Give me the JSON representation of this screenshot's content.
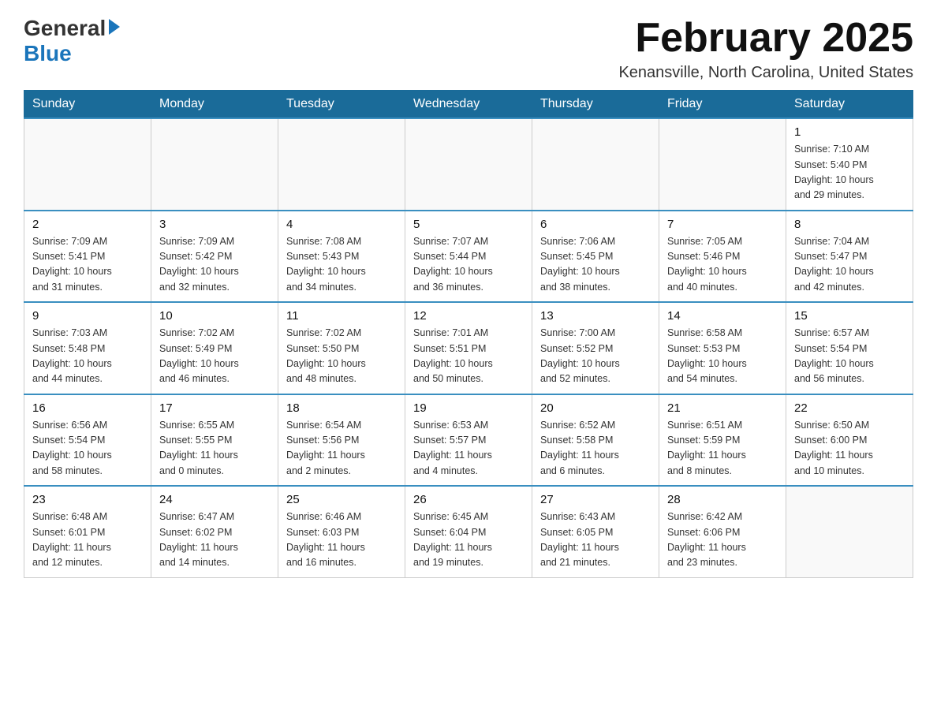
{
  "logo": {
    "line1": "General",
    "line2": "Blue"
  },
  "title": "February 2025",
  "location": "Kenansville, North Carolina, United States",
  "days_of_week": [
    "Sunday",
    "Monday",
    "Tuesday",
    "Wednesday",
    "Thursday",
    "Friday",
    "Saturday"
  ],
  "weeks": [
    [
      {
        "day": "",
        "info": ""
      },
      {
        "day": "",
        "info": ""
      },
      {
        "day": "",
        "info": ""
      },
      {
        "day": "",
        "info": ""
      },
      {
        "day": "",
        "info": ""
      },
      {
        "day": "",
        "info": ""
      },
      {
        "day": "1",
        "info": "Sunrise: 7:10 AM\nSunset: 5:40 PM\nDaylight: 10 hours\nand 29 minutes."
      }
    ],
    [
      {
        "day": "2",
        "info": "Sunrise: 7:09 AM\nSunset: 5:41 PM\nDaylight: 10 hours\nand 31 minutes."
      },
      {
        "day": "3",
        "info": "Sunrise: 7:09 AM\nSunset: 5:42 PM\nDaylight: 10 hours\nand 32 minutes."
      },
      {
        "day": "4",
        "info": "Sunrise: 7:08 AM\nSunset: 5:43 PM\nDaylight: 10 hours\nand 34 minutes."
      },
      {
        "day": "5",
        "info": "Sunrise: 7:07 AM\nSunset: 5:44 PM\nDaylight: 10 hours\nand 36 minutes."
      },
      {
        "day": "6",
        "info": "Sunrise: 7:06 AM\nSunset: 5:45 PM\nDaylight: 10 hours\nand 38 minutes."
      },
      {
        "day": "7",
        "info": "Sunrise: 7:05 AM\nSunset: 5:46 PM\nDaylight: 10 hours\nand 40 minutes."
      },
      {
        "day": "8",
        "info": "Sunrise: 7:04 AM\nSunset: 5:47 PM\nDaylight: 10 hours\nand 42 minutes."
      }
    ],
    [
      {
        "day": "9",
        "info": "Sunrise: 7:03 AM\nSunset: 5:48 PM\nDaylight: 10 hours\nand 44 minutes."
      },
      {
        "day": "10",
        "info": "Sunrise: 7:02 AM\nSunset: 5:49 PM\nDaylight: 10 hours\nand 46 minutes."
      },
      {
        "day": "11",
        "info": "Sunrise: 7:02 AM\nSunset: 5:50 PM\nDaylight: 10 hours\nand 48 minutes."
      },
      {
        "day": "12",
        "info": "Sunrise: 7:01 AM\nSunset: 5:51 PM\nDaylight: 10 hours\nand 50 minutes."
      },
      {
        "day": "13",
        "info": "Sunrise: 7:00 AM\nSunset: 5:52 PM\nDaylight: 10 hours\nand 52 minutes."
      },
      {
        "day": "14",
        "info": "Sunrise: 6:58 AM\nSunset: 5:53 PM\nDaylight: 10 hours\nand 54 minutes."
      },
      {
        "day": "15",
        "info": "Sunrise: 6:57 AM\nSunset: 5:54 PM\nDaylight: 10 hours\nand 56 minutes."
      }
    ],
    [
      {
        "day": "16",
        "info": "Sunrise: 6:56 AM\nSunset: 5:54 PM\nDaylight: 10 hours\nand 58 minutes."
      },
      {
        "day": "17",
        "info": "Sunrise: 6:55 AM\nSunset: 5:55 PM\nDaylight: 11 hours\nand 0 minutes."
      },
      {
        "day": "18",
        "info": "Sunrise: 6:54 AM\nSunset: 5:56 PM\nDaylight: 11 hours\nand 2 minutes."
      },
      {
        "day": "19",
        "info": "Sunrise: 6:53 AM\nSunset: 5:57 PM\nDaylight: 11 hours\nand 4 minutes."
      },
      {
        "day": "20",
        "info": "Sunrise: 6:52 AM\nSunset: 5:58 PM\nDaylight: 11 hours\nand 6 minutes."
      },
      {
        "day": "21",
        "info": "Sunrise: 6:51 AM\nSunset: 5:59 PM\nDaylight: 11 hours\nand 8 minutes."
      },
      {
        "day": "22",
        "info": "Sunrise: 6:50 AM\nSunset: 6:00 PM\nDaylight: 11 hours\nand 10 minutes."
      }
    ],
    [
      {
        "day": "23",
        "info": "Sunrise: 6:48 AM\nSunset: 6:01 PM\nDaylight: 11 hours\nand 12 minutes."
      },
      {
        "day": "24",
        "info": "Sunrise: 6:47 AM\nSunset: 6:02 PM\nDaylight: 11 hours\nand 14 minutes."
      },
      {
        "day": "25",
        "info": "Sunrise: 6:46 AM\nSunset: 6:03 PM\nDaylight: 11 hours\nand 16 minutes."
      },
      {
        "day": "26",
        "info": "Sunrise: 6:45 AM\nSunset: 6:04 PM\nDaylight: 11 hours\nand 19 minutes."
      },
      {
        "day": "27",
        "info": "Sunrise: 6:43 AM\nSunset: 6:05 PM\nDaylight: 11 hours\nand 21 minutes."
      },
      {
        "day": "28",
        "info": "Sunrise: 6:42 AM\nSunset: 6:06 PM\nDaylight: 11 hours\nand 23 minutes."
      },
      {
        "day": "",
        "info": ""
      }
    ]
  ]
}
